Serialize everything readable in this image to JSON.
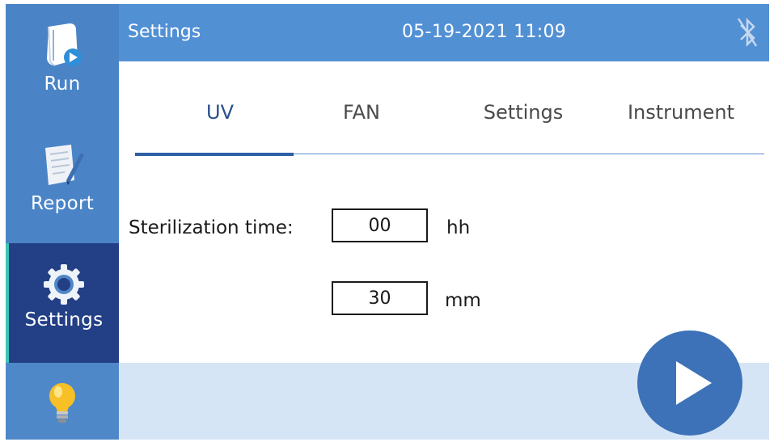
{
  "header": {
    "title": "Settings",
    "datetime": "05-19-2021 11:09"
  },
  "sidebar": {
    "items": [
      {
        "label": "Run",
        "icon": "run-document-icon"
      },
      {
        "label": "Report",
        "icon": "report-pen-icon"
      },
      {
        "label": "Settings",
        "icon": "gear-icon",
        "active": true
      },
      {
        "label": "",
        "icon": "light-bulb-icon"
      }
    ]
  },
  "tabs": [
    {
      "label": "UV",
      "active": true
    },
    {
      "label": "FAN"
    },
    {
      "label": "Settings"
    },
    {
      "label": "Instrument"
    }
  ],
  "form": {
    "sterilization_label": "Sterilization time:",
    "hours_value": "00",
    "hours_unit": "hh",
    "minutes_value": "30",
    "minutes_unit": "mm"
  },
  "icons": {
    "bluetooth": "bluetooth-disabled-icon",
    "play": "play-icon"
  },
  "colors": {
    "sidebar": "#4a84c7",
    "sidebar_active": "#233f86",
    "header": "#5290d4",
    "accent": "#3d72b8",
    "bottom_band": "#d6e5f5"
  }
}
